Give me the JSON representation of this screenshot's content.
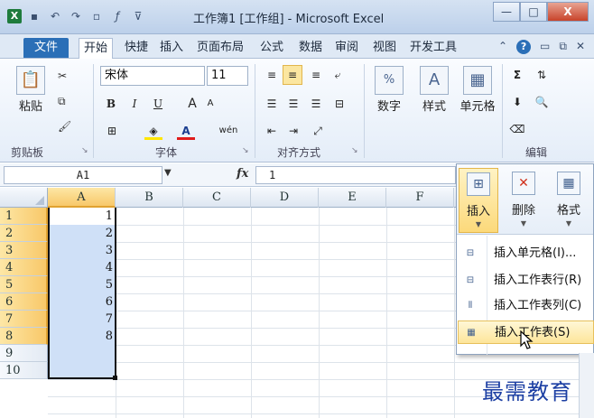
{
  "window": {
    "title": "工作簿1 [工作组] - Microsoft Excel",
    "minimize": "—",
    "maximize": "□",
    "close": "X"
  },
  "qat": {
    "app_icon": "X",
    "items": [
      "save-icon",
      "undo-icon",
      "redo-icon",
      "new-icon",
      "fx-icon",
      "customize-icon"
    ]
  },
  "tabs": {
    "file": "文件",
    "items": [
      "开始",
      "快捷",
      "插入",
      "页面布局",
      "公式",
      "数据",
      "审阅",
      "视图",
      "开发工具"
    ]
  },
  "ribbon": {
    "clipboard": {
      "paste": "粘贴",
      "label": "剪贴板"
    },
    "font": {
      "name": "宋体",
      "size": "11",
      "bold": "B",
      "italic": "I",
      "underline": "U",
      "grow": "A",
      "shrink": "A",
      "pinyin": "wén",
      "label": "字体"
    },
    "alignment": {
      "label": "对齐方式"
    },
    "number": {
      "button": "数字",
      "symbol": "%"
    },
    "styles": {
      "button": "样式"
    },
    "cells": {
      "button": "单元格"
    },
    "editing": {
      "label": "编辑",
      "sum": "Σ"
    }
  },
  "formula_bar": {
    "name_box": "A1",
    "fx": "fx",
    "value": "1"
  },
  "grid": {
    "columns": [
      "A",
      "B",
      "C",
      "D",
      "E",
      "F"
    ],
    "rows": [
      "1",
      "2",
      "3",
      "4",
      "5",
      "6",
      "7",
      "8",
      "9",
      "10"
    ],
    "col_a_values": [
      "1",
      "2",
      "3",
      "4",
      "5",
      "6",
      "7",
      "8"
    ]
  },
  "insert_menu": {
    "top_buttons": [
      {
        "label": "插入"
      },
      {
        "label": "删除"
      },
      {
        "label": "格式"
      }
    ],
    "items": [
      {
        "label": "插入单元格(I)..."
      },
      {
        "label": "插入工作表行(R)"
      },
      {
        "label": "插入工作表列(C)"
      },
      {
        "label": "插入工作表(S)"
      }
    ]
  },
  "watermark": "最需教育",
  "colors": {
    "file_tab": "#2b6fb7",
    "selection": "#cfe0f7",
    "header_selected": "#f8c869",
    "menu_highlight": "#fde59a",
    "watermark": "#1c3fa3"
  }
}
